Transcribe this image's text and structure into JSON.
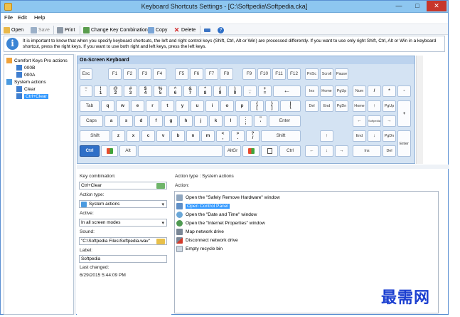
{
  "window": {
    "title": "Keyboard Shortcuts Settings - [C:\\Softpedia\\Softpedia.cka]"
  },
  "menu": [
    "File",
    "Edit",
    "Help"
  ],
  "toolbar": {
    "open": "Open",
    "save": "Save",
    "print": "Print",
    "change": "Change Key Combination",
    "copy": "Copy",
    "delete": "Delete"
  },
  "info": "It is important to know that when you specify keyboard shortcuts, the left and right control keys (Shift, Ctrl, Alt or Win) are processed differently. If you want to use only right Shift, Ctrl, Alt or Win in a keyboard shortcut, press the right keys. If you want to use both right and left keys, press the left keys.",
  "tree": {
    "root": "Comfort Keys Pro actions",
    "items": [
      "000B",
      "000A"
    ],
    "group": "System actions",
    "children": [
      "Clear",
      "Ctrl+Clear"
    ]
  },
  "keyboard": {
    "title": "On-Screen Keyboard"
  },
  "keys": {
    "esc": "Esc",
    "f": [
      "F1",
      "F2",
      "F3",
      "F4",
      "F5",
      "F6",
      "F7",
      "F8",
      "F9",
      "F10",
      "F11",
      "F12"
    ],
    "prt": "PrtSc",
    "scroll": "Scroll",
    "pause": "Pause",
    "num_row": [
      [
        "~",
        "`"
      ],
      [
        "!",
        "1"
      ],
      [
        "@",
        "2"
      ],
      [
        "#",
        "3"
      ],
      [
        "$",
        "4"
      ],
      [
        "%",
        "5"
      ],
      [
        "^",
        "6"
      ],
      [
        "&",
        "7"
      ],
      [
        "*",
        "8"
      ],
      [
        "(",
        "9"
      ],
      [
        ")",
        "0"
      ],
      [
        "_",
        "-"
      ],
      [
        "+",
        "="
      ]
    ],
    "backspace": "←",
    "ins": "Ins",
    "home": "Home",
    "pgup": "PgUp",
    "numlock": "Num",
    "slash": "/",
    "star": "*",
    "minus": "-",
    "tab": "Tab",
    "row_q": [
      "q",
      "w",
      "e",
      "r",
      "t",
      "y",
      "u",
      "i",
      "o",
      "p"
    ],
    "brl": [
      "{",
      "["
    ],
    "brr": [
      "}",
      "]"
    ],
    "bsl": [
      "|",
      "\\"
    ],
    "del": "Del",
    "end": "End",
    "pgdn": "PgDn",
    "np_home": "Home",
    "np_up": "↑",
    "np_pgup": "PgUp",
    "plus": "+",
    "caps": "Caps",
    "row_a": [
      "a",
      "s",
      "d",
      "f",
      "g",
      "h",
      "j",
      "k",
      "l"
    ],
    "semi": [
      ":",
      ";"
    ],
    "quote": [
      "\"",
      "'"
    ],
    "enter": "Enter",
    "np_left": "←",
    "np_5": "Softpedia",
    "np_right": "→",
    "shift": "Shift",
    "row_z": [
      "z",
      "x",
      "c",
      "v",
      "b",
      "n",
      "m"
    ],
    "lt": [
      "<",
      ","
    ],
    "gt": [
      ">",
      "."
    ],
    "qm": [
      "?",
      "/"
    ],
    "rshift": "Shift",
    "up": "↑",
    "np_end": "End",
    "np_down": "↓",
    "np_pgdn": "PgDn",
    "np_enter": "Enter",
    "ctrl": "Ctrl",
    "alt": "Alt",
    "altgr": "AltGr",
    "rctrl": "Ctrl",
    "left": "←",
    "down": "↓",
    "right": "→",
    "np_ins": "Ins",
    "np_del": "Del"
  },
  "form": {
    "combo_label": "Key combination:",
    "combo_value": "Ctrl+Clear",
    "type_label": "Action type:",
    "type_value": "System actions",
    "active_label": "Active:",
    "active_value": "In all screen modes",
    "sound_label": "Sound:",
    "sound_value": "\"C:\\Softpedia Files\\Softpedia.wav\"",
    "label_label": "Label:",
    "label_value": "Softpedia",
    "changed_label": "Last changed:",
    "changed_value": "6/29/2015 5:44:09 PM"
  },
  "actions": {
    "header": "Action type : System actions",
    "label": "Action:",
    "items": [
      "Open the \"Safely Remove Hardware\" window",
      "Open Control Panel",
      "Open the \"Date and Time\" window",
      "Open the \"Internet Properties\" window",
      "Map network drive",
      "Disconnect network drive",
      "Empty recycle bin"
    ]
  },
  "watermark": "最需网"
}
